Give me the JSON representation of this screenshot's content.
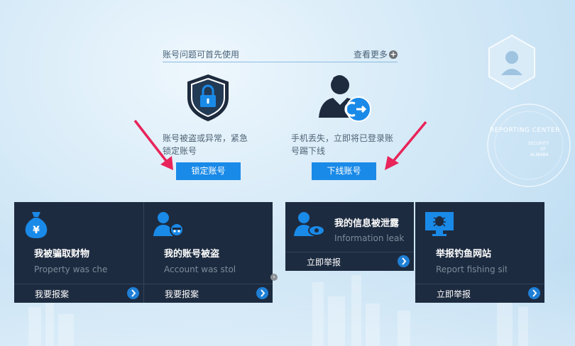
{
  "header": {
    "title": "账号问题可首先使用",
    "more": "查看更多",
    "plus": "+"
  },
  "lock_section": {
    "description": "账号被盗或异常，紧急锁定账号",
    "button": "锁定账号"
  },
  "offline_section": {
    "description": "手机丢失，立即将已登录账号踢下线",
    "button": "下线账号"
  },
  "cards": {
    "fraud": {
      "title": "我被骗取财物",
      "subtitle": "Property was che",
      "action": "我要报案"
    },
    "stolen": {
      "title": "我的账号被盗",
      "subtitle": "Account was stol",
      "action": "我要报案"
    },
    "leak": {
      "title": "我的信息被泄露",
      "subtitle": "Information leak",
      "action": "立即举报"
    },
    "phishing": {
      "title": "举报钓鱼网站",
      "subtitle": "Report fishing site",
      "action": "立即举报"
    }
  },
  "decor": {
    "reporting_center": "REPORTING CENTER",
    "security_of": "SECURITY",
    "of": "OF",
    "alibaba": "ALIBABA"
  },
  "colors": {
    "accent": "#1a8ae8",
    "card_bg": "#1d2b40",
    "arrow_pink": "#e8245a"
  }
}
